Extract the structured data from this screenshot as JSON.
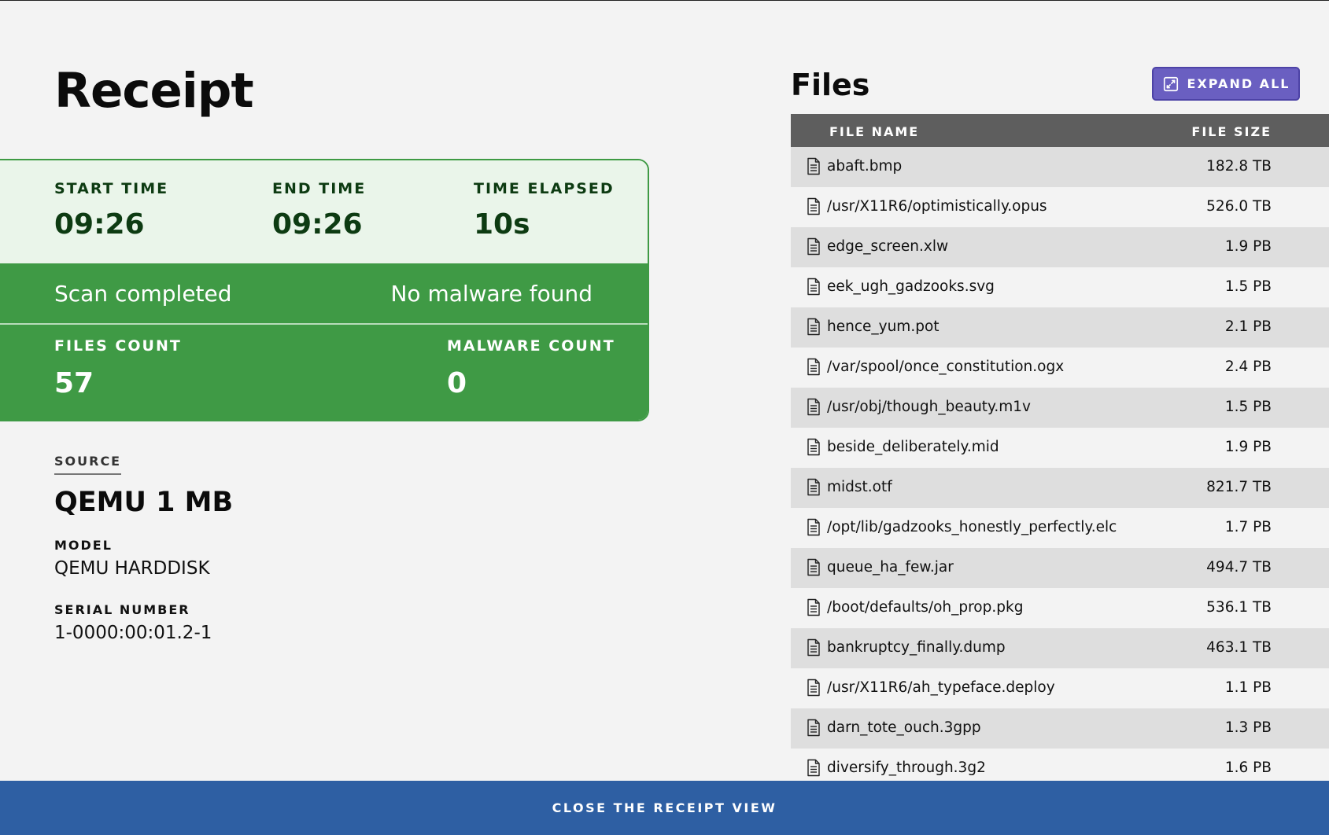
{
  "receipt": {
    "title": "Receipt",
    "times": [
      {
        "label": "START TIME",
        "value": "09:26"
      },
      {
        "label": "END TIME",
        "value": "09:26"
      },
      {
        "label": "TIME ELAPSED",
        "value": "10s"
      }
    ],
    "status_left": "Scan completed",
    "status_right": "No malware found",
    "counts": [
      {
        "label": "FILES COUNT",
        "value": "57"
      },
      {
        "label": "MALWARE COUNT",
        "value": "0"
      }
    ],
    "colors": {
      "success": "#3f9a45",
      "success_light": "#eaf5ea",
      "success_text": "#0d3b12"
    }
  },
  "source": {
    "label": "SOURCE",
    "name": "QEMU 1 MB",
    "model_label": "MODEL",
    "model_value": "QEMU HARDDISK",
    "serial_label": "SERIAL NUMBER",
    "serial_value": "1-0000:00:01.2-1"
  },
  "files": {
    "title": "Files",
    "expand_label": "EXPAND ALL",
    "expand_icon": "expand-icon",
    "columns": {
      "name": "FILE NAME",
      "size": "FILE SIZE"
    },
    "row_icon": "file-icon",
    "rows": [
      {
        "name": "abaft.bmp",
        "size": "182.8 TB"
      },
      {
        "name": "/usr/X11R6/optimistically.opus",
        "size": "526.0 TB"
      },
      {
        "name": "edge_screen.xlw",
        "size": "1.9 PB"
      },
      {
        "name": "eek_ugh_gadzooks.svg",
        "size": "1.5 PB"
      },
      {
        "name": "hence_yum.pot",
        "size": "2.1 PB"
      },
      {
        "name": "/var/spool/once_constitution.ogx",
        "size": "2.4 PB"
      },
      {
        "name": "/usr/obj/though_beauty.m1v",
        "size": "1.5 PB"
      },
      {
        "name": "beside_deliberately.mid",
        "size": "1.9 PB"
      },
      {
        "name": "midst.otf",
        "size": "821.7 TB"
      },
      {
        "name": "/opt/lib/gadzooks_honestly_perfectly.elc",
        "size": "1.7 PB"
      },
      {
        "name": "queue_ha_few.jar",
        "size": "494.7 TB"
      },
      {
        "name": "/boot/defaults/oh_prop.pkg",
        "size": "536.1 TB"
      },
      {
        "name": "bankruptcy_finally.dump",
        "size": "463.1 TB"
      },
      {
        "name": "/usr/X11R6/ah_typeface.deploy",
        "size": "1.1 PB"
      },
      {
        "name": "darn_tote_ouch.3gpp",
        "size": "1.3 PB"
      },
      {
        "name": "diversify_through.3g2",
        "size": "1.6 PB"
      }
    ]
  },
  "footer": {
    "close_label": "CLOSE THE RECEIPT VIEW",
    "color": "#2e5fa3"
  }
}
